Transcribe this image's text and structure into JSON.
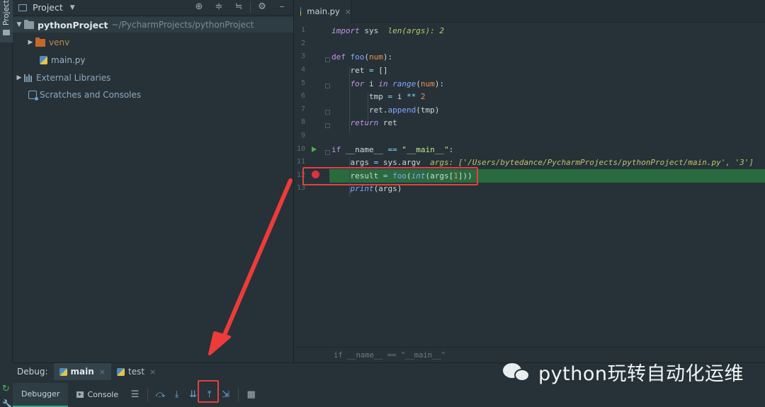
{
  "project": {
    "title": "Project",
    "root_name": "pythonProject",
    "root_path": "~/PycharmProjects/pythonProject",
    "items": [
      {
        "label": "venv"
      },
      {
        "label": "main.py"
      },
      {
        "label": "External Libraries"
      },
      {
        "label": "Scratches and Consoles"
      }
    ]
  },
  "sidebar": {
    "project_label": "Project"
  },
  "editor": {
    "tab_label": "main.py",
    "line_numbers": [
      "1",
      "2",
      "3",
      "4",
      "5",
      "6",
      "7",
      "8",
      "9",
      "10",
      "11",
      "12",
      "13"
    ],
    "hints": {
      "line1": "len(args): 2",
      "line11": "args: ['/Users/bytedance/PycharmProjects/pythonProject/main.py', '3']"
    },
    "breadcrumb": "if __name__ == \"__main__\""
  },
  "debug": {
    "label": "Debug:",
    "tabs": [
      {
        "label": "main"
      },
      {
        "label": "test"
      }
    ],
    "subtabs": {
      "debugger": "Debugger",
      "console": "Console"
    }
  },
  "watermark": {
    "text": "python玩转自动化运维"
  },
  "colors": {
    "highlight_line": "#2a6a3f",
    "breakpoint": "#e3303c",
    "annotation": "#e4403d"
  }
}
